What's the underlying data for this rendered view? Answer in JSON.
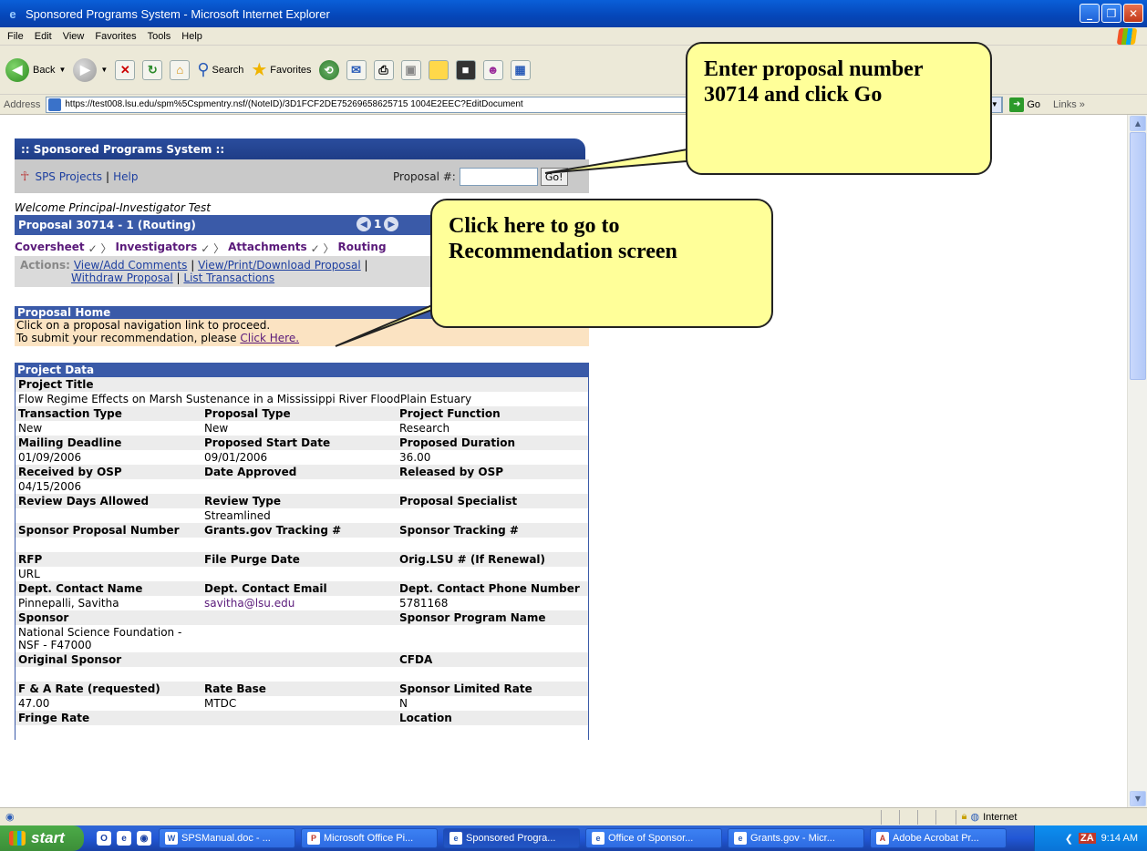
{
  "window": {
    "title": "Sponsored Programs System - Microsoft Internet Explorer"
  },
  "menu": [
    "File",
    "Edit",
    "View",
    "Favorites",
    "Tools",
    "Help"
  ],
  "toolbar": {
    "back": "Back",
    "search": "Search",
    "favorites": "Favorites"
  },
  "address": {
    "label": "Address",
    "url": "https://test008.lsu.edu/spm%5Cspmentry.nsf/(NoteID)/3D1FCF2DE75269658625715 1004E2EEC?EditDocument",
    "go": "Go",
    "links": "Links"
  },
  "sps": {
    "header": ":: Sponsored Programs System ::",
    "nav_projects": "SPS Projects",
    "nav_sep": "|",
    "nav_help": "Help",
    "proposal_label": "Proposal #:",
    "go_button": "Go!",
    "welcome": "Welcome Principal-Investigator Test",
    "proposal_title": "Proposal 30714 - 1 (Routing)",
    "page_num": "1",
    "crumbs": [
      "Coversheet",
      "Investigators",
      "Attachments",
      "Routing"
    ],
    "actions_label": "Actions:",
    "actions_links": [
      "View/Add Comments",
      "View/Print/Download Proposal",
      "Withdraw Proposal",
      "List Transactions"
    ],
    "home_title": "Proposal Home",
    "home_line1": "Click on a proposal navigation link to proceed.",
    "home_line2_prefix": "To submit your recommendation, please",
    "home_link": "Click Here."
  },
  "project": {
    "title": "Project Data",
    "project_title_label": "Project Title",
    "project_title": "Flow Regime Effects on Marsh Sustenance in a Mississippi River FloodPlain Estuary",
    "rows": [
      {
        "h": [
          "Transaction Type",
          "Proposal Type",
          "Project Function"
        ],
        "v": [
          "New",
          "New",
          "Research"
        ]
      },
      {
        "h": [
          "Mailing Deadline",
          "Proposed Start Date",
          "Proposed Duration"
        ],
        "v": [
          "01/09/2006",
          "09/01/2006",
          "36.00"
        ]
      },
      {
        "h": [
          "Received by OSP",
          "Date Approved",
          "Released by OSP"
        ],
        "v": [
          "04/15/2006",
          "",
          ""
        ]
      },
      {
        "h": [
          "Review Days Allowed",
          "Review Type",
          "Proposal Specialist"
        ],
        "v": [
          "",
          "Streamlined",
          ""
        ]
      },
      {
        "h": [
          "Sponsor Proposal Number",
          "Grants.gov Tracking #",
          "Sponsor Tracking #"
        ],
        "v": [
          "",
          "",
          ""
        ]
      },
      {
        "h": [
          "RFP",
          "File Purge Date",
          "Orig.LSU # (If Renewal)"
        ],
        "v": [
          "URL",
          "",
          ""
        ]
      },
      {
        "h": [
          "Dept. Contact Name",
          "Dept. Contact Email",
          "Dept. Contact Phone Number"
        ],
        "v": [
          "Pinnepalli, Savitha",
          "savitha@lsu.edu",
          "5781168"
        ]
      },
      {
        "h": [
          "Sponsor",
          "",
          "Sponsor Program Name"
        ],
        "v": [
          "National Science Foundation - NSF - F47000",
          "",
          ""
        ]
      },
      {
        "h": [
          "Original Sponsor",
          "",
          "CFDA"
        ],
        "v": [
          "",
          "",
          ""
        ]
      },
      {
        "h": [
          "F & A Rate (requested)",
          "Rate Base",
          "Sponsor Limited Rate"
        ],
        "v": [
          "47.00",
          "MTDC",
          "N"
        ]
      },
      {
        "h": [
          "Fringe Rate",
          "",
          "Location"
        ],
        "v": [
          "",
          "",
          ""
        ]
      }
    ]
  },
  "callouts": {
    "enter": "Enter proposal number 30714 and click Go",
    "click": "Click here to go to Recommendation screen"
  },
  "status": {
    "zone": "Internet"
  },
  "taskbar": {
    "start": "start",
    "tasks": [
      "SPSManual.doc - ...",
      "Microsoft Office Pi...",
      "Sponsored Progra...",
      "Office of Sponsor...",
      "Grants.gov - Micr...",
      "Adobe Acrobat Pr..."
    ],
    "tray_badge": "ZA",
    "clock": "9:14 AM"
  }
}
